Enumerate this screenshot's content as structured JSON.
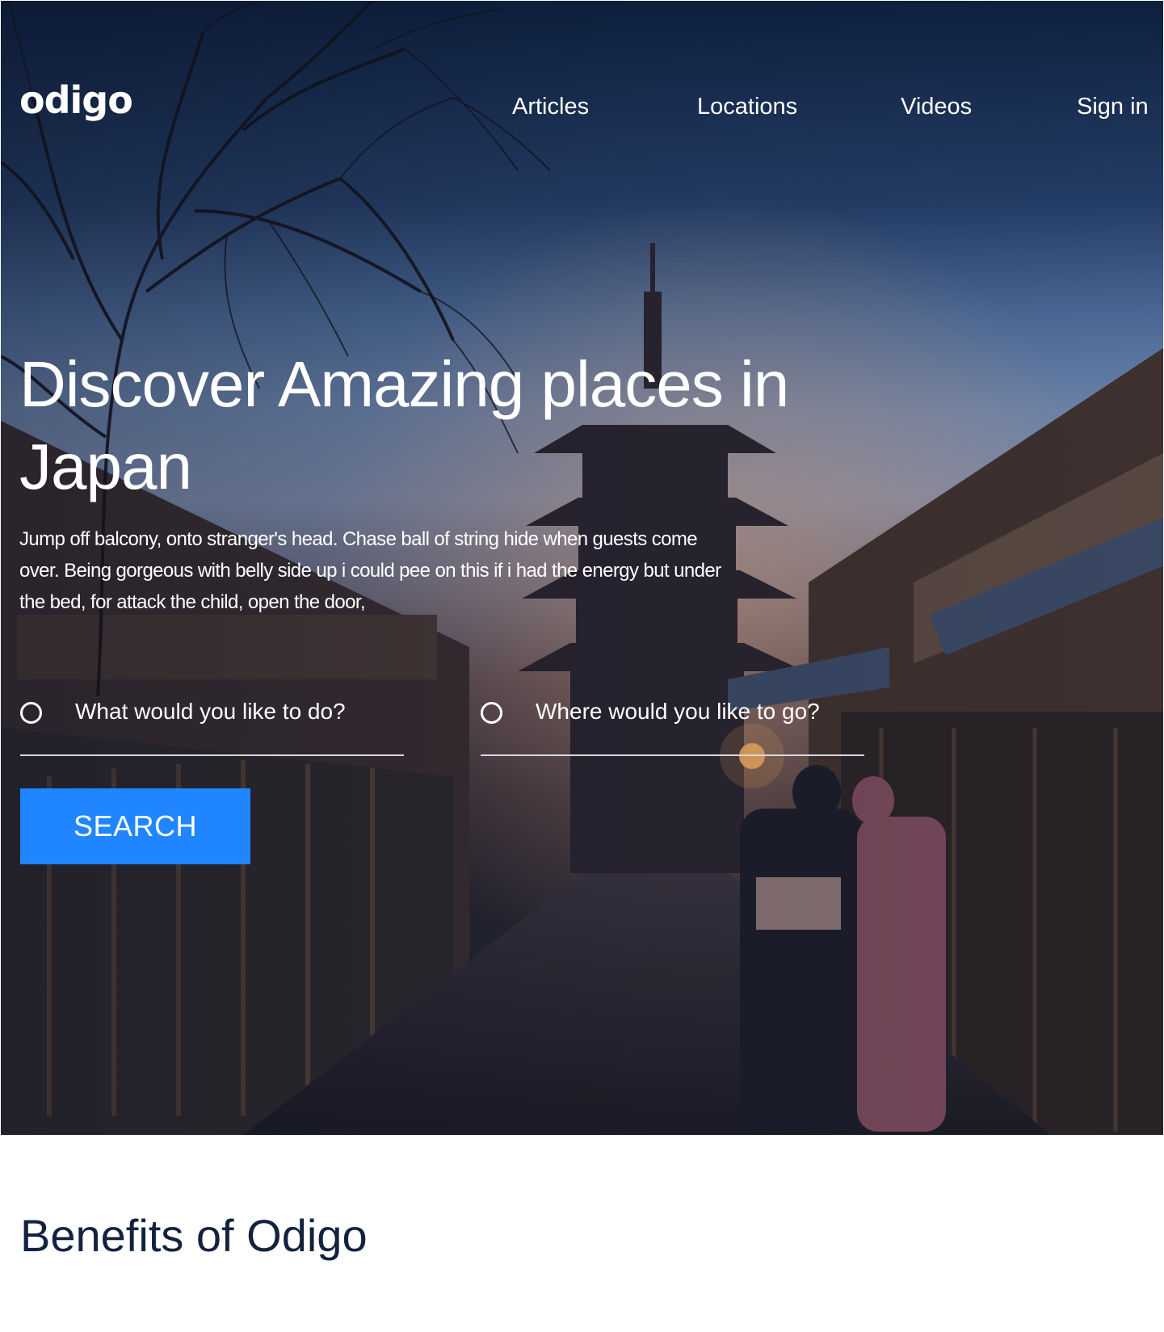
{
  "header": {
    "logo_text": "odigo",
    "nav": {
      "articles": "Articles",
      "locations": "Locations",
      "videos": "Videos",
      "sign_in": "Sign in"
    }
  },
  "hero": {
    "title": "Discover Amazing places in Japan",
    "description": "Jump off balcony, onto stranger's head. Chase ball of string hide when guests come over. Being gorgeous with belly side up i could pee on this if i had the energy but under the bed, for attack the child, open the door,",
    "search_form": {
      "activity_placeholder": "What would you like to do?",
      "activity_value": "",
      "location_placeholder": "Where would you like to go?",
      "location_value": "",
      "search_button": "SEARCH"
    }
  },
  "benefits": {
    "title": "Benefits of Odigo"
  },
  "colors": {
    "accent": "#1f86ff",
    "heading_dark": "#13233f",
    "input_underline": "#d7d7dd"
  },
  "icons": {
    "activity_field_icon": "radio-circle-icon",
    "location_field_icon": "radio-circle-icon"
  }
}
